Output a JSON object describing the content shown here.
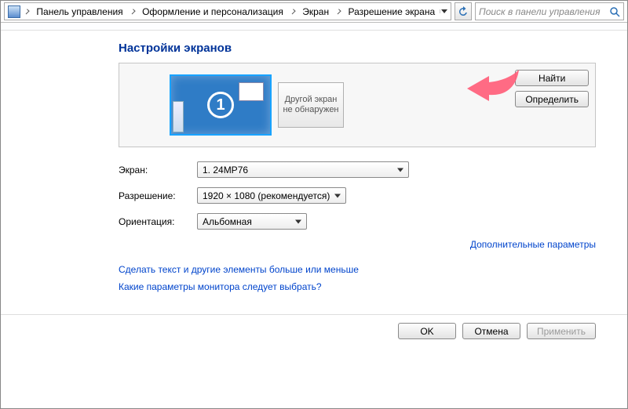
{
  "breadcrumb": {
    "items": [
      "Панель управления",
      "Оформление и персонализация",
      "Экран",
      "Разрешение экрана"
    ]
  },
  "search": {
    "placeholder": "Поиск в панели управления"
  },
  "page_title": "Настройки экранов",
  "displays": {
    "primary_number": "1",
    "ghost_label": "Другой экран не обнаружен",
    "find_label": "Найти",
    "identify_label": "Определить"
  },
  "form": {
    "screen_label": "Экран:",
    "screen_value": "1. 24MP76",
    "resolution_label": "Разрешение:",
    "resolution_value": "1920 × 1080 (рекомендуется)",
    "orientation_label": "Ориентация:",
    "orientation_value": "Альбомная"
  },
  "advanced_link": "Дополнительные параметры",
  "help": {
    "text_size": "Сделать текст и другие элементы больше или меньше",
    "which_monitor": "Какие параметры монитора следует выбрать?"
  },
  "dialog": {
    "ok": "OK",
    "cancel": "Отмена",
    "apply": "Применить"
  }
}
